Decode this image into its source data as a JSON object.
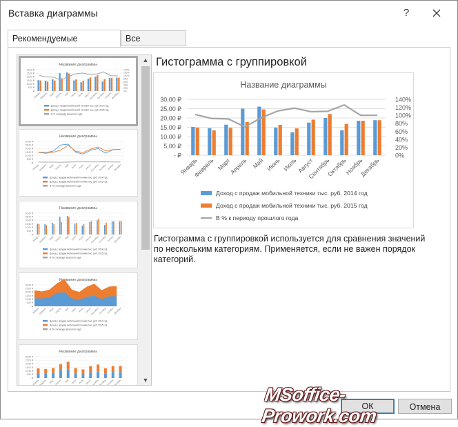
{
  "dialog": {
    "title": "Вставка диаграммы",
    "help_label": "?",
    "tabs": [
      {
        "label": "Рекомендуемые диаграммы"
      },
      {
        "label": "Все диаграммы"
      }
    ],
    "preview_title": "Гистограмма с группировкой",
    "description": "Гистограмма с группировкой используется для сравнения значений по нескольким категориям. Применяется, если не важен порядок категорий.",
    "ok_label": "ОК",
    "cancel_label": "Отмена",
    "watermark": "MSoffice-Prowork.com"
  },
  "colors": {
    "series1": "#5b9bd5",
    "series2": "#ed7d31",
    "series3": "#a5a5a5",
    "accent": "#3c7fb1"
  },
  "chart_data": {
    "type": "bar",
    "title": "Название диаграммы",
    "categories": [
      "Январь",
      "Февраль",
      "Март",
      "Апрель",
      "Май",
      "Июнь",
      "Июль",
      "Август",
      "Сентябрь",
      "Октябрь",
      "Ноябрь",
      "Декабрь"
    ],
    "series": [
      {
        "name": "Доход с продаж мобильной техники тыс. руб. 2014 год",
        "type": "bar",
        "axis": "left",
        "values": [
          15.2,
          14.5,
          16.4,
          25.0,
          26.1,
          14.8,
          12.3,
          17.5,
          20.0,
          13.4,
          18.5,
          18.8
        ]
      },
      {
        "name": "Доход с продаж мобильной техники тыс. руб. 2015 год",
        "type": "bar",
        "axis": "left",
        "values": [
          14.8,
          13.3,
          14.7,
          17.8,
          24.6,
          16.3,
          14.4,
          19.1,
          22.1,
          16.8,
          18.5,
          18.8
        ]
      },
      {
        "name": "В % к периоду прошлого года",
        "type": "line",
        "axis": "right",
        "values": [
          102,
          92,
          91,
          71,
          94,
          111,
          118,
          109,
          110,
          126,
          100,
          100
        ]
      }
    ],
    "y_left": {
      "ticks": [
        "30,00 ₽",
        "25,00 ₽",
        "20,00 ₽",
        "15,00 ₽",
        "10,00 ₽",
        "5,00 ₽",
        "- ₽"
      ],
      "ylim": [
        0,
        30
      ]
    },
    "y_right": {
      "ticks": [
        "140%",
        "120%",
        "100%",
        "80%",
        "60%",
        "40%",
        "20%",
        "0%"
      ],
      "ylim": [
        0,
        140
      ]
    },
    "legend": "bottom",
    "grid": true
  }
}
